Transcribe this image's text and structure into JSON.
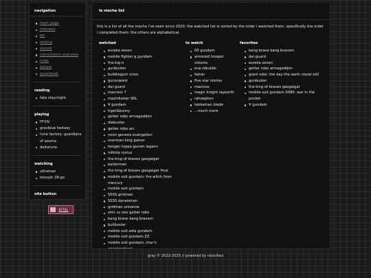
{
  "sidebar": {
    "navigation": {
      "heading": "navigation",
      "items": [
        "main page",
        "interests",
        "art",
        "writing",
        "socials",
        "commission overview",
        "rules",
        "paypal",
        "guestbook"
      ]
    },
    "reading": {
      "heading": "reading",
      "items": [
        "fate stay/night"
      ]
    },
    "playing": {
      "heading": "playing",
      "items": [
        "FFXIV",
        "granblue fantasy",
        "rune factory: guardians of azuma",
        "deltarune"
      ]
    },
    "watching": {
      "heading": "watching",
      "items": [
        "ultraman",
        "tetsujin 28-go"
      ]
    },
    "site_button": {
      "heading": "site button",
      "button_text": "OCT4L"
    }
  },
  "main": {
    "title": "le mecha list",
    "intro": "this is a list of all the mecha i've seen since 2020. the watched list is sorted by the order i watched them, specifically the order i completed them. the others are alphabetical.",
    "columns": {
      "watched": {
        "heading": "watched",
        "items": [
          "eureka seven",
          "mobile fighter g gundam",
          "the big o",
          "gunbuster",
          "bubblegum crisis",
          "gunxsword",
          "dai-guard",
          "macross 7",
          "mazinkaiser SKL",
          "∀ gundam",
          "tiger&bunny",
          "getter robo armageddon",
          "diebuster",
          "getter robo arc",
          "neon genesis evangelion",
          "overman king gainer",
          "tengen toppa gurren lagann",
          "infinite ryvius",
          "the king of braves gaogaigar",
          "betterman",
          "the king of braves gaogaigar final",
          "mobile suit gundam: the witch from mercury",
          "mobile suit gundam",
          "SSSS.gridman",
          "SSSS.dynazenon",
          "gridman universe",
          "shin vs neo getter robo",
          "bang brave bang bravern",
          "bullbuster",
          "mobile suit zeta gundam",
          "mobile suit gundam ZZ",
          "mobile suit gundam: char's counterattack"
        ]
      },
      "to_watch": {
        "heading": "to watch",
        "items": [
          "00 gundam",
          "armored trooper votoms",
          "eva rebuilds",
          "fafner",
          "five star stories",
          "macross",
          "magic knight rayearth",
          "rahxephon",
          "tekkaman blade",
          "...much more"
        ]
      },
      "favorites": {
        "heading": "favorites",
        "items": [
          "bang brave bang bravern",
          "dai-guard",
          "eureka seven",
          "getter robo armageddon",
          "giant robo: the day the earth stood still",
          "gunbuster",
          "the king of braves gaogaigar",
          "mobile suit gundam 0080: war in the pocket",
          "∀ gundam"
        ]
      }
    }
  },
  "footer": "gray © 2022-2025 // powered by neocities"
}
